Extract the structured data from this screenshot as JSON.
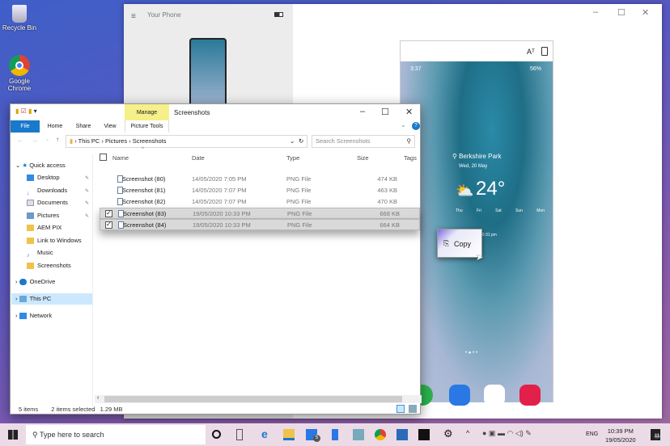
{
  "desktop": {
    "icons": [
      {
        "label": "Recycle Bin"
      },
      {
        "label": "Google Chrome"
      }
    ]
  },
  "your_phone": {
    "title": "Your Phone",
    "phone": {
      "time": "3:37",
      "battery": "56%",
      "location": "Berkshire Park",
      "date": "Wed, 20 May",
      "temperature": "24°",
      "forecast": [
        "Thu",
        "Fri",
        "Sat",
        "Sun",
        "Mon"
      ],
      "updated": "10:31 pm"
    }
  },
  "drag": {
    "label": "Copy"
  },
  "explorer": {
    "title": "Screenshots",
    "context_tab": "Manage",
    "context_group": "Picture Tools",
    "tabs": [
      "File",
      "Home",
      "Share",
      "View"
    ],
    "address": [
      "This PC",
      "Pictures",
      "Screenshots"
    ],
    "search_placeholder": "Search Screenshots",
    "columns": [
      "Name",
      "Date",
      "Type",
      "Size",
      "Tags"
    ],
    "nav": {
      "quick_access": "Quick access",
      "pinned": [
        "Desktop",
        "Downloads",
        "Documents",
        "Pictures"
      ],
      "folders": [
        "AEM PIX",
        "Link to Windows",
        "Music",
        "Screenshots"
      ],
      "onedrive": "OneDrive",
      "this_pc": "This PC",
      "network": "Network"
    },
    "files": [
      {
        "name": "Screenshot (80)",
        "date": "14/05/2020 7:05 PM",
        "type": "PNG File",
        "size": "474 KB",
        "selected": false
      },
      {
        "name": "Screenshot (81)",
        "date": "14/05/2020 7:07 PM",
        "type": "PNG File",
        "size": "463 KB",
        "selected": false
      },
      {
        "name": "Screenshot (82)",
        "date": "14/05/2020 7:07 PM",
        "type": "PNG File",
        "size": "470 KB",
        "selected": false
      },
      {
        "name": "Screenshot (83)",
        "date": "19/05/2020 10:33 PM",
        "type": "PNG File",
        "size": "668 KB",
        "selected": true
      },
      {
        "name": "Screenshot (84)",
        "date": "19/05/2020 10:33 PM",
        "type": "PNG File",
        "size": "664 KB",
        "selected": true
      }
    ],
    "status": {
      "count": "5 items",
      "selected": "2 items selected",
      "size": "1.29 MB"
    }
  },
  "taskbar": {
    "search_placeholder": "Type here to search",
    "mail_badge": "5",
    "lang": "ENG",
    "time": "10:39 PM",
    "date": "19/05/2020",
    "notifications": "11"
  },
  "colors": {
    "accent": "#1979ca",
    "manage": "#f6f08a",
    "selection": "#d9d9d9",
    "nav_selected": "#cce8ff"
  }
}
